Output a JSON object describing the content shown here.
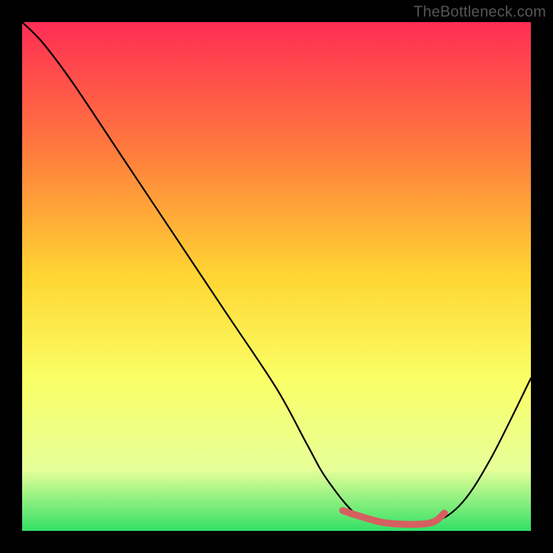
{
  "watermark": "TheBottleneck.com",
  "chart_data": {
    "type": "line",
    "title": "",
    "xlabel": "",
    "ylabel": "",
    "xlim": [
      0,
      100
    ],
    "ylim": [
      0,
      100
    ],
    "series": [
      {
        "name": "curve",
        "x": [
          0,
          4,
          10,
          20,
          30,
          40,
          50,
          56,
          60,
          66,
          72,
          80,
          86,
          92,
          100
        ],
        "values": [
          100,
          96,
          88,
          73,
          58,
          43,
          28,
          17,
          10,
          3,
          1.5,
          1.5,
          5,
          14,
          30
        ]
      }
    ],
    "highlight_segment": {
      "name": "plateau",
      "x": [
        63,
        66,
        72,
        80,
        83
      ],
      "values": [
        4,
        3,
        1.5,
        1.5,
        3.5
      ]
    },
    "background_gradient": {
      "top": "#ff2d55",
      "mid_upper": "#ff7a3d",
      "mid": "#ffd633",
      "mid_lower": "#faff66",
      "lower": "#e6ff99",
      "bottom": "#33e066"
    }
  }
}
